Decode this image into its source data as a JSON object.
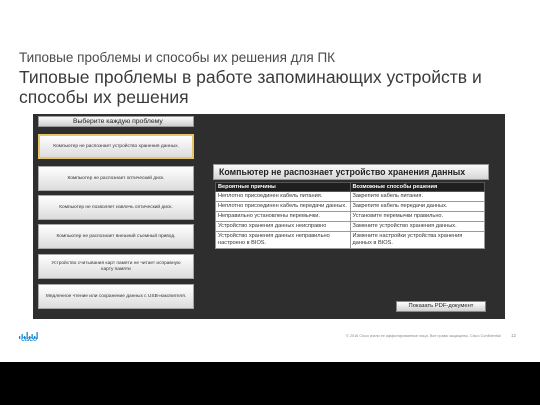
{
  "header": {
    "subtitle": "Типовые проблемы и способы их решения для ПК",
    "title": "Типовые проблемы в работе запоминающих устройств и способы их решения"
  },
  "left_panel": {
    "heading": "Выберите каждую проблему",
    "problems": [
      "Компьютер не распознает устройство хранения данных.",
      "Компьютер не распознает оптический диск.",
      "Компьютер не позволяет извлечь оптический диск.",
      "Компьютер не распознает внешний съемный привод.",
      "Устройство считывания карт памяти не читает исправную карту памяти",
      "Медленное чтение или сохранение данных с USB-накопителя."
    ]
  },
  "card": {
    "title": "Компьютер не распознает устройство хранения данных",
    "columns": [
      "Вероятные причины",
      "Возможные способы решения"
    ],
    "rows": [
      [
        "Неплотно присоединен кабель питания.",
        "Закрепите кабель питания."
      ],
      [
        "Неплотно присоединен кабель передачи данных.",
        "Закрепите кабель передачи данных."
      ],
      [
        "Неправильно установлены перемычки.",
        "Установите перемычки правильно."
      ],
      [
        "Устройство хранения данных неисправно",
        "Замените устройство хранения данных."
      ],
      [
        "Устройство хранения данных неправильно настроено в BIOS.",
        "Измените настройки устройства хранения данных в BIOS."
      ]
    ]
  },
  "pdf_button": "Показать PDF-документ",
  "footer": {
    "logo_text": "CISCO",
    "copyright": "© 2016 Cisco и/или ее аффилированные лица. Все права защищены. Cisco Confidential",
    "page": "12"
  },
  "colors": {
    "logo": "#1a8ad4",
    "active_border": "#e8c46a",
    "panel_bg": "#2e2e2e"
  }
}
